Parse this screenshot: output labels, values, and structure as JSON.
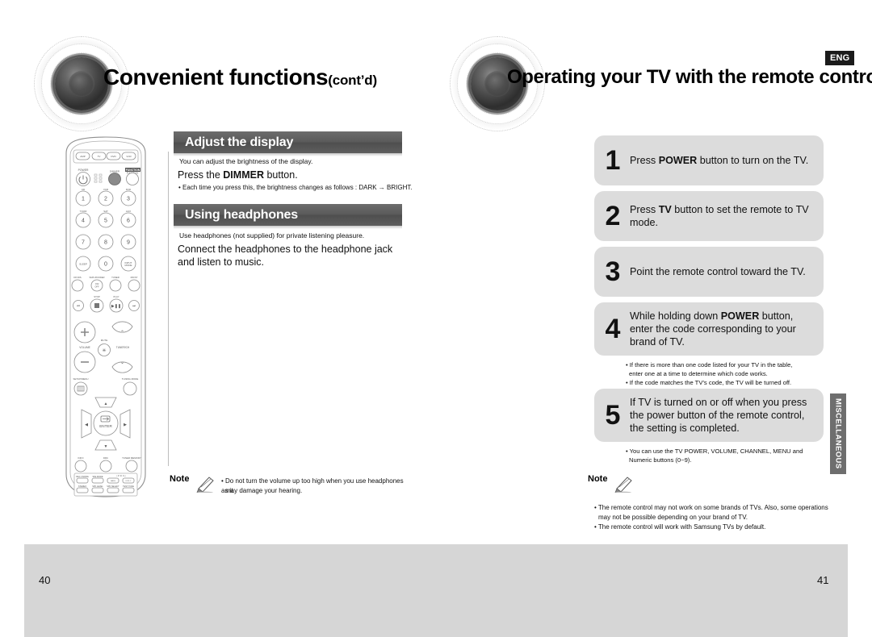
{
  "document": {
    "language_badge": "ENG",
    "side_tab": "MISCELLANEOUS"
  },
  "left_page": {
    "page_number": "40",
    "title": "Convenient functions",
    "title_suffix": "(cont’d)",
    "sections": [
      {
        "heading": "Adjust the display",
        "intro": "You can adjust the brightness of the display.",
        "instruction_prefix": "Press the ",
        "instruction_bold": "DIMMER",
        "instruction_suffix": " button.",
        "bullet": "• Each time you press this, the brightness changes as follows : DARK → BRIGHT."
      },
      {
        "heading": "Using headphones",
        "intro": "Use headphones (not supplied) for private listening pleasure.",
        "instruction": "Connect the headphones to the headphone jack and listen to music."
      }
    ],
    "note": {
      "label": "Note",
      "lines": [
        "• Do not turn the volume up too high when you use headphones as it",
        "may damage your hearing."
      ]
    }
  },
  "right_page": {
    "page_number": "41",
    "title": "Operating your TV with the remote control",
    "steps": [
      {
        "number": "1",
        "text_parts": [
          "Press ",
          "POWER",
          " button to turn on the TV."
        ],
        "notes": []
      },
      {
        "number": "2",
        "text_parts": [
          "Press ",
          "TV",
          " button to set the remote to TV mode."
        ],
        "notes": []
      },
      {
        "number": "3",
        "text_parts": [
          "Point the remote control toward the TV.",
          "",
          ""
        ],
        "notes": []
      },
      {
        "number": "4",
        "text_parts": [
          "While holding down ",
          "POWER",
          " button, enter the code corresponding to your brand of TV."
        ],
        "notes": [
          "• If there is more than one code listed for your TV in the table,",
          "enter one at a time to determine which code works.",
          "• If the code matches the TV’s code, the TV will be turned off."
        ]
      },
      {
        "number": "5",
        "text_parts": [
          "If TV is turned on or off when you press the power button of the remote control, the setting is completed.",
          "",
          ""
        ],
        "notes": [
          "• You can use the TV POWER, VOLUME, CHANNEL, MENU and",
          "Numeric buttons (0~9)."
        ]
      }
    ],
    "note": {
      "label": "Note",
      "lines": [
        "• The remote control may not work on some brands of TVs. Also, some operations",
        "may not be possible depending on your brand of TV.",
        "• The remote control will work with Samsung TVs by default."
      ]
    }
  },
  "remote": {
    "mode_buttons": [
      "AMP",
      "TV",
      "DVD",
      "VCR"
    ],
    "power_label": "POWER",
    "dimmer_label": "DIMMER",
    "function_label": "FUNCTION",
    "sleep_label": "SLEEP",
    "keypad": [
      {
        "key": "1",
        "above": "CD"
      },
      {
        "key": "2",
        "above": "VCR"
      },
      {
        "key": "3",
        "above": "DVD"
      },
      {
        "key": "4",
        "above": "T.KOR"
      },
      {
        "key": "5",
        "above": "SAT"
      },
      {
        "key": "6",
        "above": "AUX"
      },
      {
        "key": "7",
        "above": ""
      },
      {
        "key": "8",
        "above": ""
      },
      {
        "key": "9",
        "above": ""
      },
      {
        "key": "0",
        "above": ""
      }
    ],
    "sleep_key": "SLEEP",
    "input_mode_key": "INPUT MODE",
    "row_labels": [
      "DIVX",
      "SUB WOOFER",
      "TUNER",
      "MO/ST"
    ],
    "transport_labels": [
      "STOP",
      "PLAY"
    ],
    "volume_label": "VOLUME",
    "mute_label": "MUTE",
    "tuner_ch_label": "TUNER/CH",
    "setup_menu_label": "SETUP/MENU",
    "tuning_mode_label": "TUNING MODE",
    "enter_label": "ENTER",
    "bottom_labels": [
      "INFO",
      "DRC",
      "TUNER MEMORY"
    ],
    "bottom_grid_top": [
      "REC 3 MODE",
      "SFE MODE",
      "P.BASS",
      "DYN.C"
    ],
    "bottom_grid_bot": [
      "STEREO",
      "SPK LEVEL",
      "SPK SELECT",
      "TEST TONE"
    ],
    "highlights_right": [
      "TV",
      "POWER"
    ],
    "highlights_left": [
      "DIMMER"
    ]
  },
  "colors": {
    "bar_gray": "#5a5a5a",
    "step_gray": "#dcdcdc",
    "band_gray": "#d6d6d6",
    "tab_gray": "#6e6e6e",
    "badge_black": "#1b1b1b"
  }
}
